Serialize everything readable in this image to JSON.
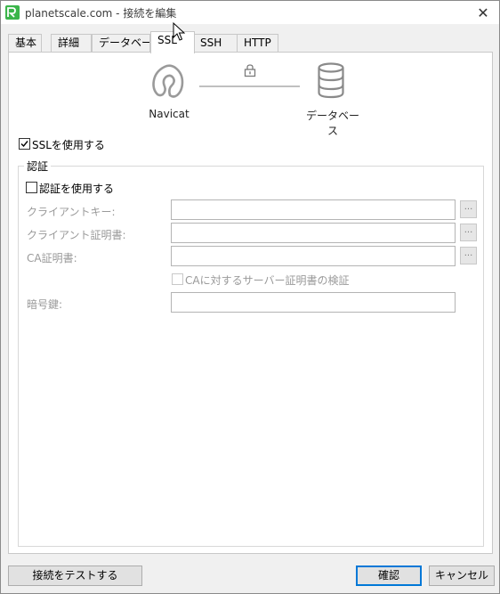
{
  "window": {
    "title": "planetscale.com - 接続を編集",
    "close_glyph": "✕"
  },
  "tabs": [
    {
      "label": "基本",
      "active": false
    },
    {
      "label": "詳細",
      "active": false
    },
    {
      "label": "データベース",
      "active": false
    },
    {
      "label": "SSL",
      "active": true
    },
    {
      "label": "SSH",
      "active": false
    },
    {
      "label": "HTTP",
      "active": false
    }
  ],
  "diagram": {
    "left_label": "Navicat",
    "right_label": "データベース",
    "icons": [
      "navicat-logo-icon",
      "lock-icon",
      "database-icon"
    ]
  },
  "ssl": {
    "use_ssl_label": "SSLを使用する",
    "use_ssl_checked": true,
    "group_title": "認証",
    "use_auth_label": "認証を使用する",
    "use_auth_checked": false,
    "client_key_label": "クライアントキー:",
    "client_key_value": "",
    "client_cert_label": "クライアント証明書:",
    "client_cert_value": "",
    "ca_cert_label": "CA証明書:",
    "ca_cert_value": "",
    "verify_ca_label": "CAに対するサーバー証明書の検証",
    "verify_ca_checked": false,
    "cipher_label": "暗号鍵:",
    "cipher_value": "",
    "browse_label": "..."
  },
  "footer": {
    "test_label": "接続をテストする",
    "ok_label": "確認",
    "cancel_label": "キャンセル"
  },
  "colors": {
    "accent": "#0078d7",
    "app_icon": "#3bb54a"
  }
}
